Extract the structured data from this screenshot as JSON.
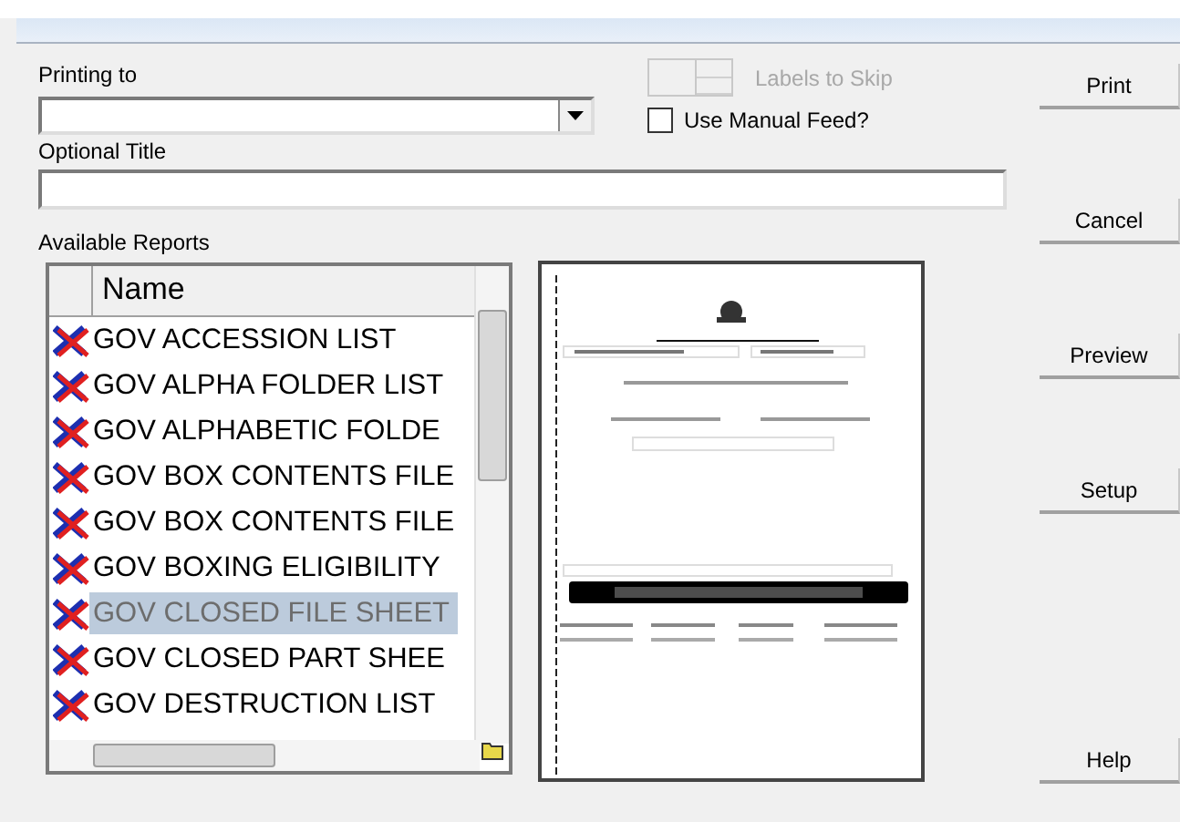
{
  "printing_to": {
    "label": "Printing to"
  },
  "labels_to_skip": {
    "label": "Labels to Skip",
    "disabled": true
  },
  "manual_feed": {
    "label": "Use Manual Feed?",
    "checked": false
  },
  "optional_title": {
    "label": "Optional Title"
  },
  "available_reports": {
    "label": "Available Reports",
    "columns": [
      "Name"
    ],
    "rows": [
      {
        "name": "GOV ACCESSION LIST",
        "selected": false
      },
      {
        "name": "GOV ALPHA FOLDER LIST",
        "selected": false
      },
      {
        "name": "GOV ALPHABETIC FOLDE",
        "selected": false
      },
      {
        "name": "GOV BOX CONTENTS FILE",
        "selected": false
      },
      {
        "name": "GOV BOX CONTENTS FILE",
        "selected": false
      },
      {
        "name": "GOV BOXING ELIGIBILITY",
        "selected": false
      },
      {
        "name": "GOV CLOSED FILE SHEET",
        "selected": true
      },
      {
        "name": "GOV CLOSED PART SHEE",
        "selected": false
      },
      {
        "name": "GOV DESTRUCTION LIST",
        "selected": false
      }
    ]
  },
  "buttons": [
    "Print",
    "Cancel",
    "Preview",
    "Setup",
    "Help"
  ]
}
